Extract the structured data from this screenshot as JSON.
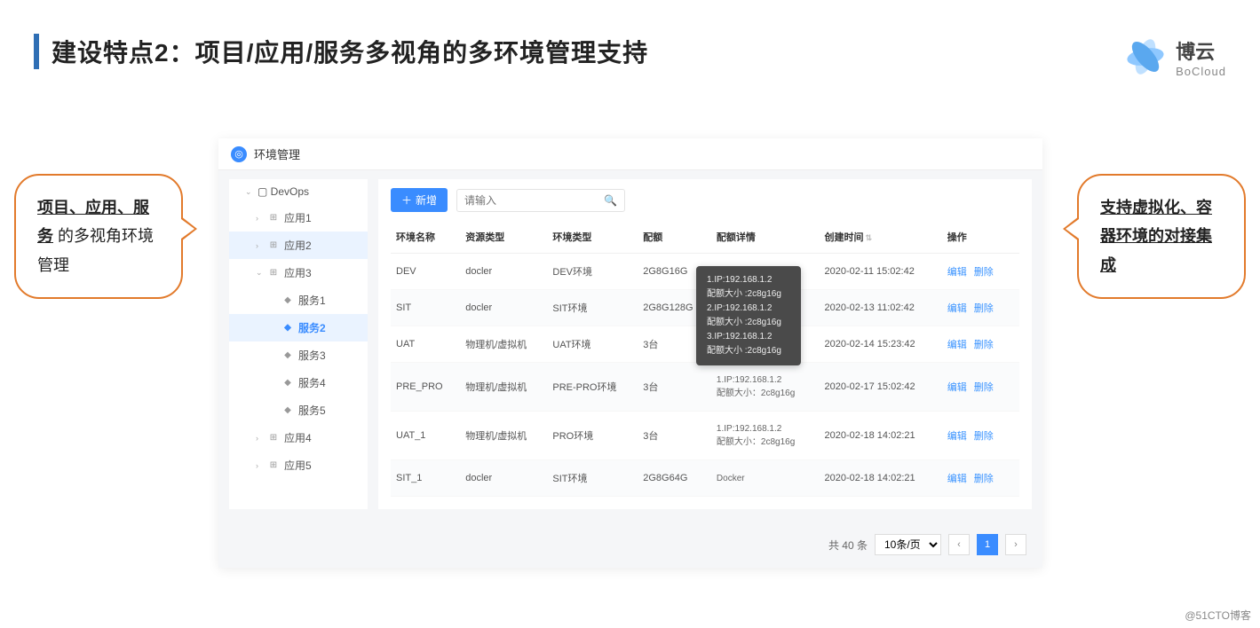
{
  "title": "建设特点2：项目/应用/服务多视角的多环境管理支持",
  "logo": {
    "cn": "博云",
    "en": "BoCloud"
  },
  "callouts": {
    "left": {
      "bold": "项目、应用、服务",
      "rest": " 的多视角环境管理"
    },
    "right": {
      "bold": "支持虚拟化、容器环境的对接集成",
      "rest": ""
    }
  },
  "app": {
    "header_title": "环境管理",
    "tree": {
      "root": "DevOps",
      "items": [
        {
          "label": "应用1",
          "level": 1,
          "caret": "›",
          "ico": "app"
        },
        {
          "label": "应用2",
          "level": 1,
          "caret": "›",
          "ico": "app",
          "selected": true
        },
        {
          "label": "应用3",
          "level": 1,
          "caret": "⌄",
          "ico": "app"
        },
        {
          "label": "服务1",
          "level": 2,
          "ico": "svc"
        },
        {
          "label": "服务2",
          "level": 2,
          "ico": "svc",
          "active": true
        },
        {
          "label": "服务3",
          "level": 2,
          "ico": "svc"
        },
        {
          "label": "服务4",
          "level": 2,
          "ico": "svc"
        },
        {
          "label": "服务5",
          "level": 2,
          "ico": "svc"
        },
        {
          "label": "应用4",
          "level": 1,
          "caret": "›",
          "ico": "app"
        },
        {
          "label": "应用5",
          "level": 1,
          "caret": "›",
          "ico": "app"
        }
      ]
    },
    "toolbar": {
      "new_btn": "新增",
      "search_placeholder": "请输入"
    },
    "columns": [
      "环境名称",
      "资源类型",
      "环境类型",
      "配额",
      "配额详情",
      "创建时间",
      "操作"
    ],
    "ops": {
      "edit": "编辑",
      "delete": "删除"
    },
    "rows": [
      {
        "name": "DEV",
        "res": "docler",
        "env": "DEV环境",
        "quota": "2G8G16G",
        "detail": "",
        "time": "2020-02-11  15:02:42"
      },
      {
        "name": "SIT",
        "res": "docler",
        "env": "SIT环境",
        "quota": "2G8G128G",
        "detail": "",
        "time": "2020-02-13  11:02:42",
        "alt": true,
        "tooltip": true
      },
      {
        "name": "UAT",
        "res": "物理机/虚拟机",
        "env": "UAT环境",
        "quota": "3台",
        "detail": "",
        "time": "2020-02-14  15:23:42"
      },
      {
        "name": "PRE_PRO",
        "res": "物理机/虚拟机",
        "env": "PRE-PRO环境",
        "quota": "3台",
        "detail": "1.IP:192.168.1.2\n配额大小：2c8g16g",
        "time": "2020-02-17  15:02:42",
        "alt": true
      },
      {
        "name": "UAT_1",
        "res": "物理机/虚拟机",
        "env": "PRO环境",
        "quota": "3台",
        "detail": "1.IP:192.168.1.2\n配额大小：2c8g16g",
        "time": "2020-02-18  14:02:21"
      },
      {
        "name": "SIT_1",
        "res": "docler",
        "env": "SIT环境",
        "quota": "2G8G64G",
        "detail": "Docker",
        "time": "2020-02-18  14:02:21",
        "alt": true
      }
    ],
    "tooltip_lines": [
      "1.IP:192.168.1.2",
      "配额大小 :2c8g16g",
      "2.IP:192.168.1.2",
      "配额大小 :2c8g16g",
      "3.IP:192.168.1.2",
      "配额大小 :2c8g16g"
    ],
    "pager": {
      "total_label": "共 40 条",
      "page_size": "10条/页",
      "current": "1"
    }
  },
  "watermark": "@51CTO博客"
}
